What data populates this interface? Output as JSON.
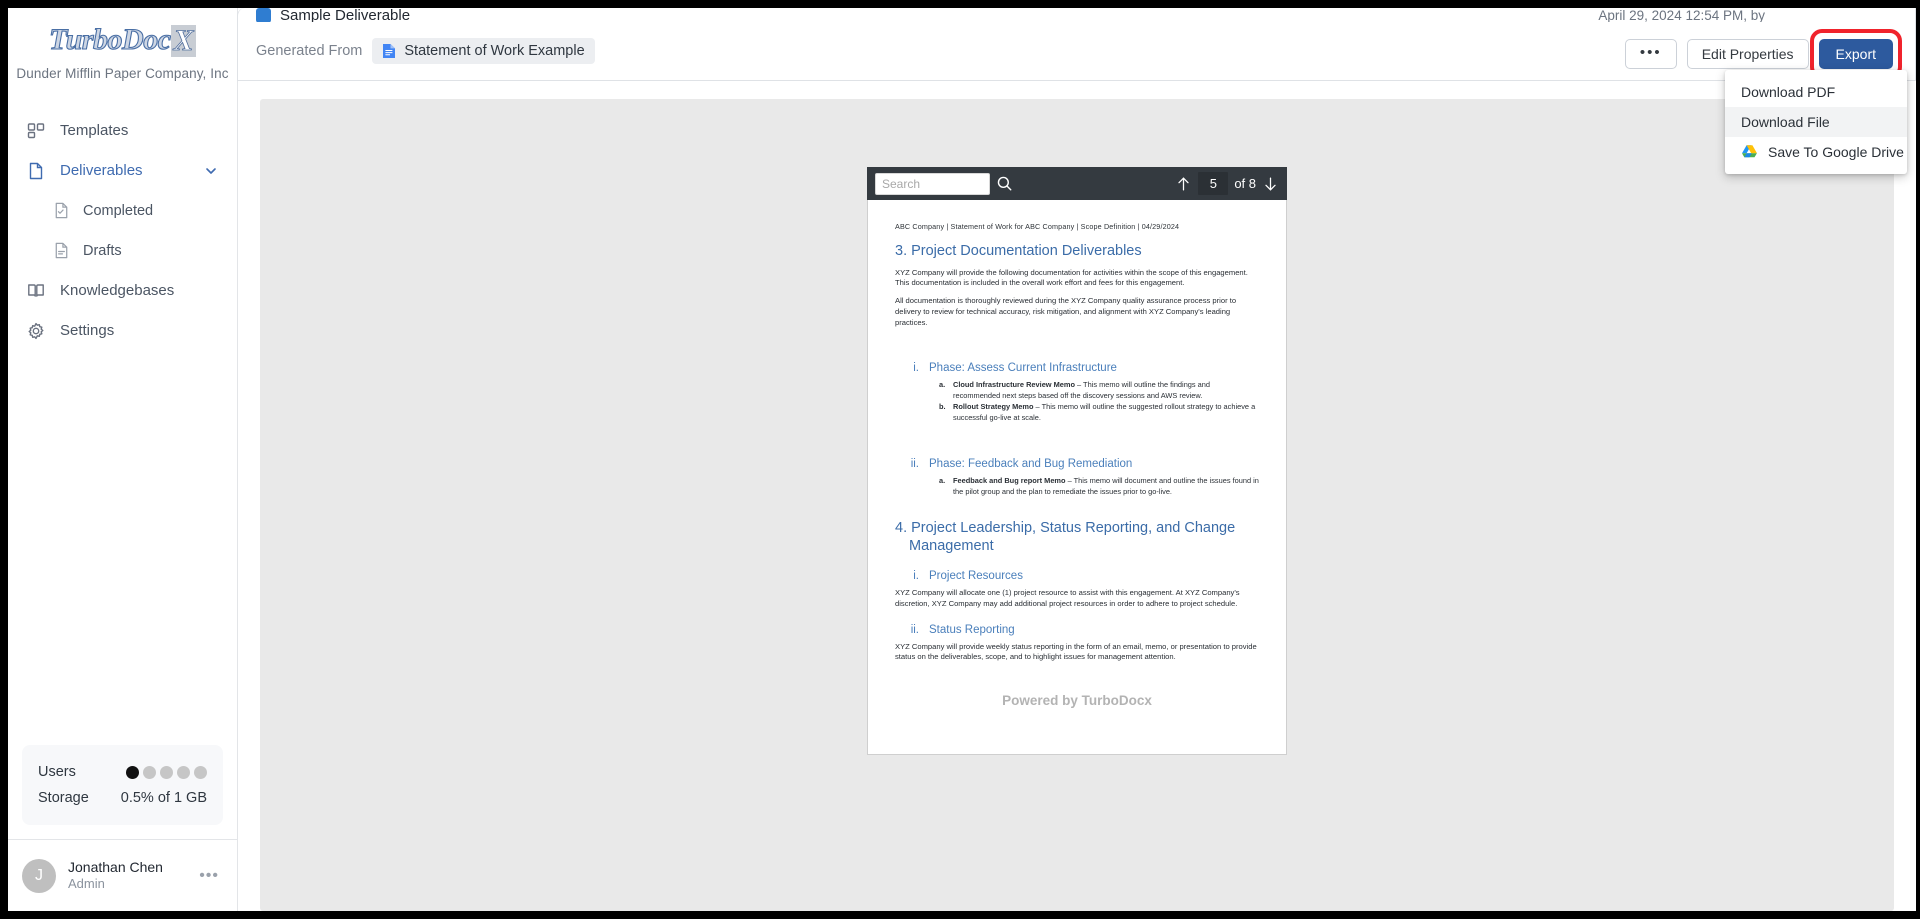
{
  "sidebar": {
    "logo_main": "TurboDoc",
    "logo_badge": "X",
    "org_name": "Dunder Mifflin Paper Company, Inc",
    "items": [
      {
        "label": "Templates",
        "icon": "templates-icon"
      },
      {
        "label": "Deliverables",
        "icon": "document-icon"
      },
      {
        "label": "Completed",
        "icon": "document-check-icon"
      },
      {
        "label": "Drafts",
        "icon": "document-lines-icon"
      },
      {
        "label": "Knowledgebases",
        "icon": "book-icon"
      },
      {
        "label": "Settings",
        "icon": "gear-icon"
      }
    ],
    "usage": {
      "users_label": "Users",
      "users_filled": 1,
      "users_total": 5,
      "storage_label": "Storage",
      "storage_value": "0.5% of 1 GB"
    },
    "user": {
      "initial": "J",
      "name": "Jonathan Chen",
      "role": "Admin",
      "more": "•••"
    }
  },
  "header": {
    "doc_title": "Sample Deliverable",
    "doc_date": "April 29, 2024 12:54 PM, by",
    "generated_from_label": "Generated From",
    "generated_from_value": "Statement of Work Example",
    "buttons": {
      "more": "•••",
      "edit_properties": "Edit Properties",
      "export": "Export"
    },
    "highlight_color": "#f0232c",
    "export_color": "#2d5a9e"
  },
  "export_menu": {
    "items": [
      {
        "label": "Download PDF",
        "icon": null,
        "hover": false
      },
      {
        "label": "Download File",
        "icon": null,
        "hover": true
      },
      {
        "label": "Save To Google Drive",
        "icon": "google-drive-icon",
        "hover": false
      }
    ]
  },
  "pdf_toolbar": {
    "search_placeholder": "Search",
    "search_value": "",
    "page_current": "5",
    "page_total": "of 8"
  },
  "document": {
    "meta_line": "ABC Company | Statement of Work for ABC Company | Scope Definition | 04/29/2024",
    "section3_title": "3. Project Documentation Deliverables",
    "section3_p1": "XYZ Company will provide the following documentation for activities within the scope of this engagement.  This documentation is included in the overall work effort and fees for this engagement.",
    "section3_p2": "All documentation is thoroughly reviewed during the XYZ Company quality assurance process prior to delivery to review for technical accuracy, risk mitigation, and alignment with XYZ Company's leading practices.",
    "phase1_num": "i.",
    "phase1_title": "Phase: Assess Current Infrastructure",
    "phase1_a_letter": "a.",
    "phase1_a_bold": "Cloud Infrastructure Review Memo",
    "phase1_a_text": " – This memo will outline the findings and recommended next steps based off the discovery sessions and AWS review.",
    "phase1_b_letter": "b.",
    "phase1_b_bold": "Rollout Strategy Memo",
    "phase1_b_text": " – This memo will outline the suggested rollout strategy to achieve a successful go-live at scale.",
    "phase2_num": "ii.",
    "phase2_title": "Phase: Feedback and Bug Remediation",
    "phase2_a_letter": "a.",
    "phase2_a_bold": "Feedback and Bug report Memo",
    "phase2_a_text": " – This memo will document and outline the issues found in the pilot group and the plan to remediate the issues prior to go-live.",
    "section4_title": "4. Project Leadership, Status Reporting, and Change Management",
    "sub1_num": "i.",
    "sub1_title": "Project Resources",
    "sub1_p": "XYZ Company will allocate one (1) project resource to assist with this engagement. At XYZ Company's discretion, XYZ Company may add additional project resources in order to adhere to project schedule.",
    "sub2_num": "ii.",
    "sub2_title": "Status Reporting",
    "sub2_p": "XYZ Company will provide weekly status reporting in the form of an email, memo, or presentation to provide status on the deliverables, scope, and to highlight issues for management attention.",
    "footer": "Powered by TurboDocx"
  }
}
